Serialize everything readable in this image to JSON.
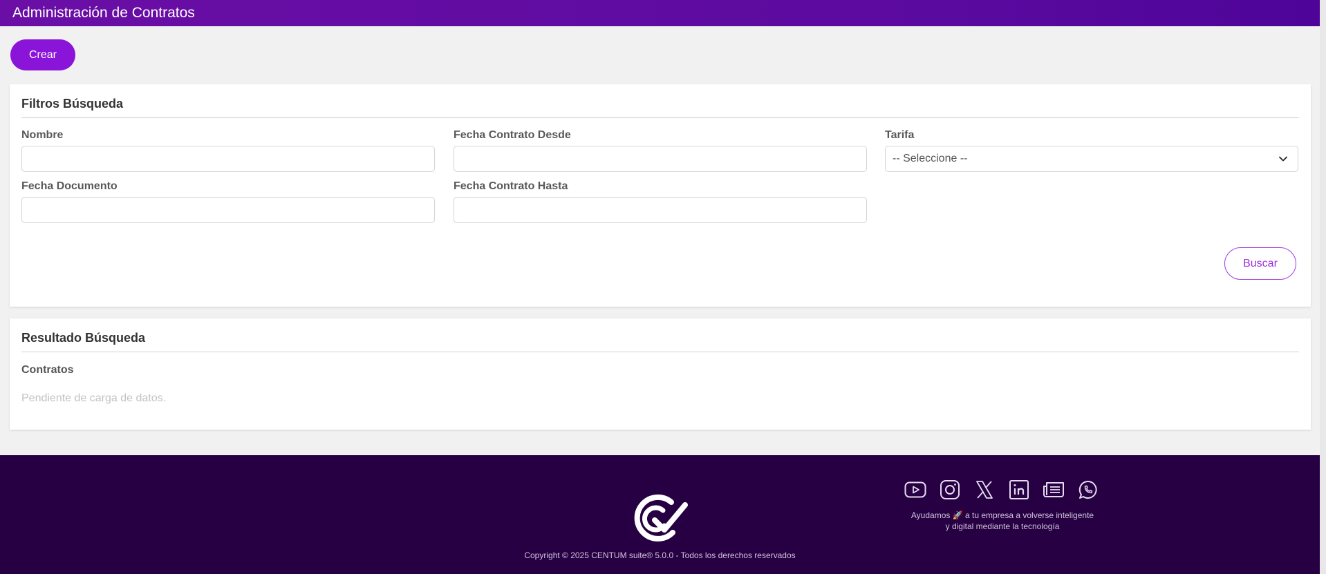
{
  "header": {
    "title": "Administración de Contratos"
  },
  "toolbar": {
    "create_label": "Crear"
  },
  "filters": {
    "title": "Filtros Búsqueda",
    "nombre": {
      "label": "Nombre",
      "value": ""
    },
    "fecha_documento": {
      "label": "Fecha Documento",
      "value": ""
    },
    "fecha_desde": {
      "label": "Fecha Contrato Desde",
      "value": ""
    },
    "fecha_hasta": {
      "label": "Fecha Contrato Hasta",
      "value": ""
    },
    "tarifa": {
      "label": "Tarifa",
      "selected": "-- Seleccione --"
    },
    "search_label": "Buscar"
  },
  "results": {
    "title": "Resultado Búsqueda",
    "subtitle": "Contratos",
    "empty_message": "Pendiente de carga de datos."
  },
  "footer": {
    "copyright": "Copyright © 2025 CENTUM suite® 5.0.0 - Todos los derechos reservados",
    "tagline_line1": "Ayudamos 🚀 a tu empresa a volverse inteligente",
    "tagline_line2": "y digital mediante la tecnología",
    "social_icons": [
      "youtube-icon",
      "instagram-icon",
      "x-icon",
      "linkedin-icon",
      "news-icon",
      "whatsapp-icon"
    ]
  },
  "colors": {
    "header_bg": "#5b0a9f",
    "primary_button": "#8a14d8",
    "footer_bg": "#270043",
    "page_bg": "#f1f1f1"
  }
}
